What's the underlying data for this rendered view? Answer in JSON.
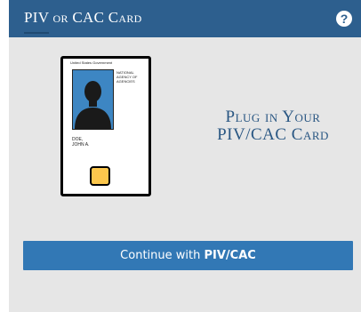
{
  "header": {
    "title": "PIV or CAC Card",
    "help_icon": "question-mark-icon",
    "help_glyph": "?"
  },
  "card": {
    "government_text": "United States Government",
    "agency_text": "NATIONAL AGENCY OF AGENCIES",
    "name_line_1": "DOE,",
    "name_line_2": "JOHN A."
  },
  "instruction": {
    "line_1": "Plug in Your",
    "line_2": "PIV/CAC Card"
  },
  "continue_button": {
    "prefix": "Continue with ",
    "emphasis": "PIV/CAC"
  },
  "colors": {
    "header_bg": "#2d5f8e",
    "panel_bg": "#e6e6e6",
    "button_bg": "#3278b5",
    "chip": "#fcc74d",
    "photo_bg": "#3d86c3",
    "instruction_text": "#2a5783"
  }
}
